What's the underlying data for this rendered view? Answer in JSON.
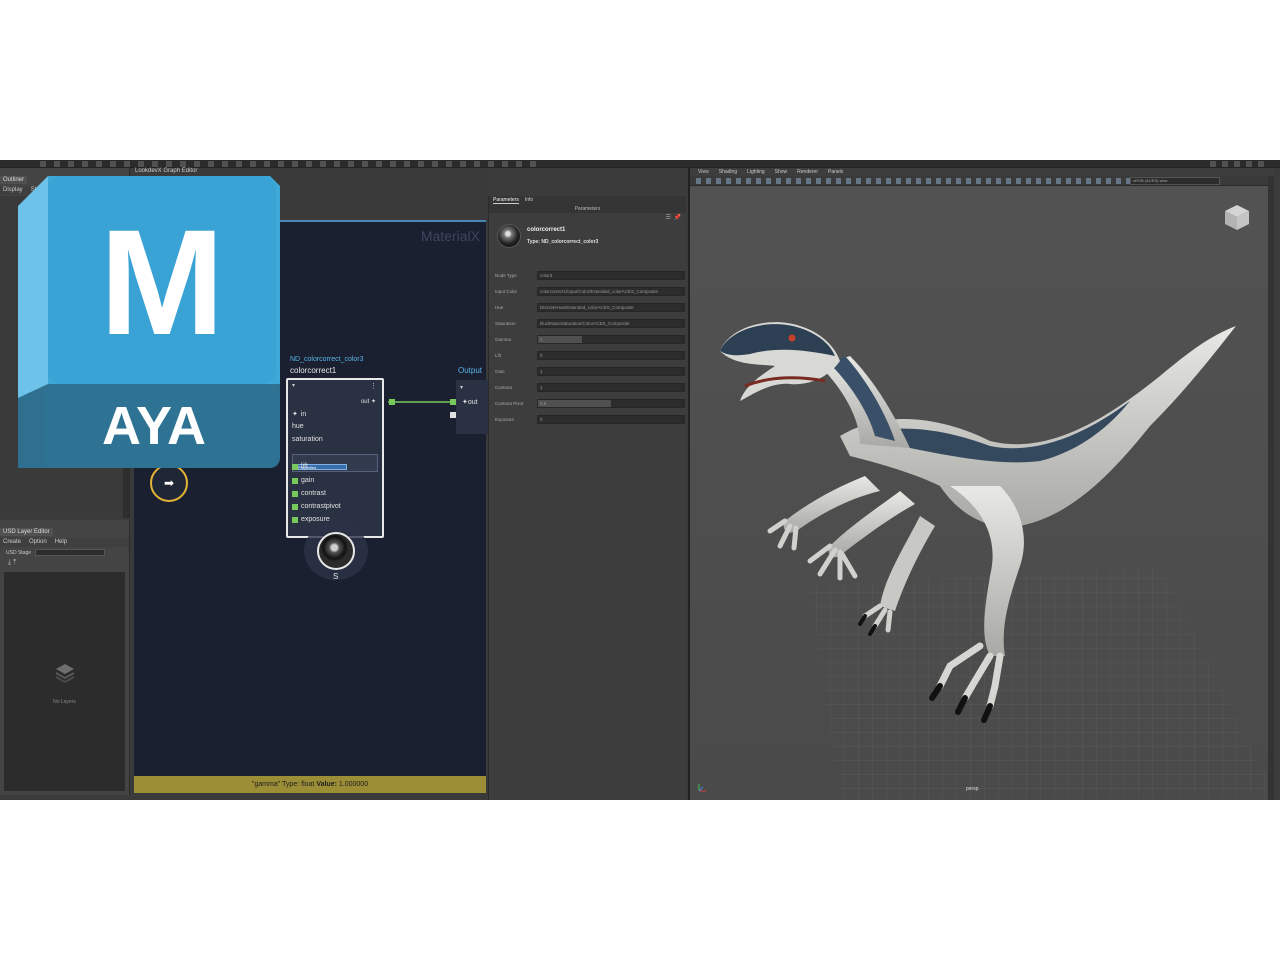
{
  "logo": {
    "letter": "M",
    "word": "AYA"
  },
  "outliner": {
    "title": "Outliner",
    "menu": [
      "Display",
      "Show"
    ]
  },
  "layer_editor": {
    "title": "USD Layer Editor",
    "menu": [
      "Create",
      "Option",
      "Help"
    ],
    "stage_label": "USD Stage",
    "empty_label": "No Layers"
  },
  "graph_editor": {
    "title": "LookdevX Graph Editor",
    "watermark": "MaterialX",
    "node_path": "ND_colorcorrect_color3",
    "node_title": "colorcorrect1",
    "out_label": "out",
    "ports": [
      "in",
      "hue",
      "saturation",
      "lift",
      "gain",
      "contrast",
      "contrastpivot",
      "exposure"
    ],
    "dropdown_item": "Properties",
    "output_node": {
      "title": "Output",
      "port": "out"
    },
    "swatch_label": "S",
    "nav_icon": "arrow-right-icon",
    "status": {
      "prefix": "\"gamma\"",
      "type_label": "Type:",
      "type_value": "float",
      "value_label": "Value:",
      "value": "1.000000"
    }
  },
  "parameters": {
    "tabs": [
      "Parameters",
      "Info"
    ],
    "header": "Parameters",
    "node_name": "colorcorrect1",
    "node_type": "Type: ND_colorcorrect_color3",
    "rows": [
      {
        "label": "Node Type",
        "value": "color3",
        "fill": 0
      },
      {
        "label": "Input Color",
        "value": "colorcorrect1/Input/Color/Extended_colorACES_Composite",
        "fill": 0
      },
      {
        "label": "Hue",
        "value": "DIscreteHue/Extended_colorACES_Composite",
        "fill": 0
      },
      {
        "label": "Saturation",
        "value": "IlluckNaseSaturation/ColorACES_Composite",
        "fill": 0
      },
      {
        "label": "Gamma",
        "value": "1",
        "fill": 0.3
      },
      {
        "label": "Lift",
        "value": "0",
        "fill": 0
      },
      {
        "label": "Gain",
        "value": "1",
        "fill": 0
      },
      {
        "label": "Contrast",
        "value": "1",
        "fill": 0
      },
      {
        "label": "Contrast Pivot",
        "value": "0.5",
        "fill": 0.5
      },
      {
        "label": "Exposure",
        "value": "0",
        "fill": 0
      }
    ]
  },
  "viewport": {
    "menu": [
      "View",
      "Shading",
      "Lighting",
      "Show",
      "Renderer",
      "Panels"
    ],
    "combo": "sRGB (ACES) view",
    "camera_label": "persp"
  }
}
